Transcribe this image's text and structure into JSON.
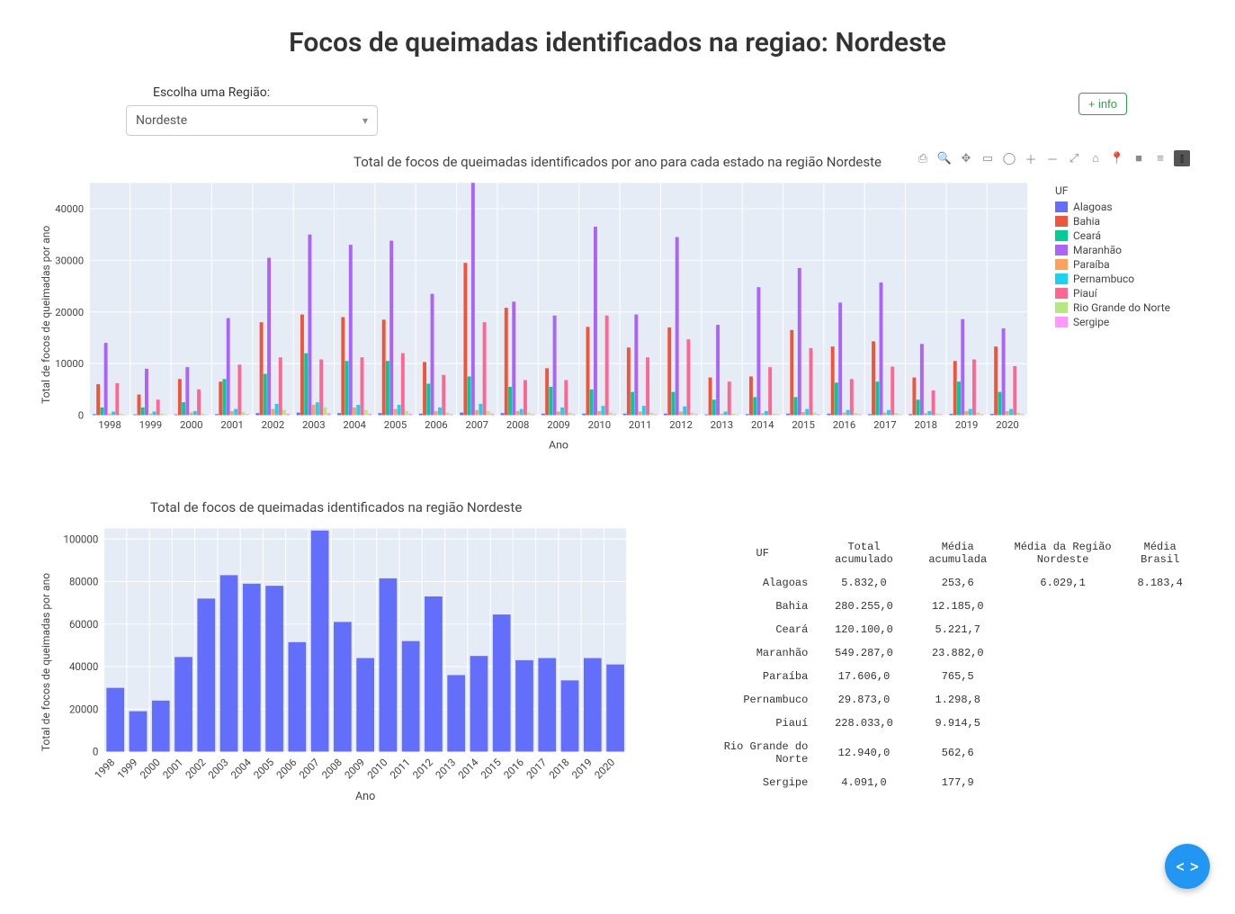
{
  "page": {
    "title": "Focos de queimadas identificados na regiao: Nordeste",
    "region_label": "Escolha uma Região:",
    "region_value": "Nordeste",
    "info_button": "+ info"
  },
  "chart_data": [
    {
      "type": "bar",
      "title": "Total de focos de queimadas identificados por ano para cada estado na região Nordeste",
      "xlabel": "Ano",
      "ylabel": "Total de focos de queimadas por ano",
      "legend": {
        "title": "UF",
        "position": "right"
      },
      "categories": [
        "1998",
        "1999",
        "2000",
        "2001",
        "2002",
        "2003",
        "2004",
        "2005",
        "2006",
        "2007",
        "2008",
        "2009",
        "2010",
        "2011",
        "2012",
        "2013",
        "2014",
        "2015",
        "2016",
        "2017",
        "2018",
        "2019",
        "2020"
      ],
      "yticks": [
        0,
        10000,
        20000,
        30000,
        40000
      ],
      "ylim": [
        0,
        45000
      ],
      "series": [
        {
          "name": "Alagoas",
          "color": "#636efa",
          "values": [
            200,
            150,
            150,
            200,
            400,
            500,
            400,
            400,
            300,
            500,
            400,
            300,
            300,
            300,
            300,
            150,
            200,
            300,
            300,
            200,
            200,
            250,
            250
          ]
        },
        {
          "name": "Bahia",
          "color": "#ef553b",
          "values": [
            6000,
            4000,
            7000,
            6500,
            18000,
            19500,
            19000,
            18500,
            10300,
            29500,
            20800,
            9100,
            17100,
            13100,
            17000,
            7300,
            7500,
            16500,
            13300,
            14300,
            7300,
            10500,
            13300
          ]
        },
        {
          "name": "Ceará",
          "color": "#00cc96",
          "values": [
            1500,
            1500,
            2500,
            7000,
            8000,
            12000,
            10500,
            10500,
            6100,
            7500,
            5500,
            5500,
            5000,
            4500,
            4500,
            3000,
            3500,
            3500,
            6300,
            6500,
            3000,
            6500,
            4500
          ]
        },
        {
          "name": "Maranhão",
          "color": "#ab63fa",
          "values": [
            14000,
            9000,
            9300,
            18800,
            30500,
            35000,
            33000,
            33800,
            23500,
            45000,
            22000,
            19300,
            36500,
            19500,
            34500,
            17500,
            24800,
            28500,
            21800,
            25700,
            13800,
            18600,
            16800
          ]
        },
        {
          "name": "Paraíba",
          "color": "#ffa15a",
          "values": [
            300,
            300,
            500,
            800,
            1200,
            2000,
            1500,
            1200,
            800,
            1000,
            800,
            700,
            800,
            700,
            700,
            300,
            400,
            600,
            500,
            500,
            400,
            800,
            800
          ]
        },
        {
          "name": "Pernambuco",
          "color": "#19d3f3",
          "values": [
            700,
            700,
            800,
            1200,
            2200,
            2500,
            2000,
            2000,
            1500,
            2200,
            1200,
            1500,
            1800,
            1800,
            1700,
            700,
            800,
            1200,
            1000,
            1000,
            800,
            1200,
            1200
          ]
        },
        {
          "name": "Piauí",
          "color": "#ff6692",
          "values": [
            6200,
            3000,
            5000,
            9800,
            11200,
            10800,
            11200,
            12000,
            7800,
            18000,
            6800,
            6800,
            19300,
            11200,
            14700,
            6500,
            9300,
            13000,
            7000,
            9400,
            4800,
            10800,
            9500
          ]
        },
        {
          "name": "Rio Grande do Norte",
          "color": "#b6e880",
          "values": [
            300,
            300,
            300,
            600,
            1000,
            1500,
            1000,
            800,
            500,
            800,
            500,
            500,
            500,
            500,
            500,
            300,
            300,
            500,
            400,
            400,
            300,
            500,
            500
          ]
        },
        {
          "name": "Sergipe",
          "color": "#ff97ff",
          "values": [
            100,
            100,
            100,
            200,
            300,
            400,
            300,
            300,
            200,
            300,
            200,
            200,
            200,
            200,
            200,
            100,
            150,
            200,
            200,
            150,
            150,
            200,
            200
          ]
        }
      ]
    },
    {
      "type": "bar",
      "title": "Total de focos de queimadas identificados na região Nordeste",
      "xlabel": "Ano",
      "ylabel": "Total de focos de queimadas por ano",
      "categories": [
        "1998",
        "1999",
        "2000",
        "2001",
        "2002",
        "2003",
        "2004",
        "2005",
        "2006",
        "2007",
        "2008",
        "2009",
        "2010",
        "2011",
        "2012",
        "2013",
        "2014",
        "2015",
        "2016",
        "2017",
        "2018",
        "2019",
        "2020"
      ],
      "yticks": [
        0,
        20000,
        40000,
        60000,
        80000,
        100000
      ],
      "ylim": [
        0,
        105000
      ],
      "values": [
        30000,
        19000,
        24000,
        44500,
        72000,
        83000,
        79000,
        78000,
        51500,
        104000,
        61000,
        44000,
        81500,
        52000,
        73000,
        36000,
        45000,
        64500,
        43000,
        44000,
        33500,
        44000,
        41000
      ],
      "color": "#636efa"
    }
  ],
  "table": {
    "headers": [
      "UF",
      "Total acumulado",
      "Média acumulada",
      "Média da Região Nordeste",
      "Média Brasil"
    ],
    "rows": [
      {
        "uf": "Alagoas",
        "total": "5.832,0",
        "media": "253,6",
        "media_reg": "6.029,1",
        "media_br": "8.183,4"
      },
      {
        "uf": "Bahia",
        "total": "280.255,0",
        "media": "12.185,0",
        "media_reg": "",
        "media_br": ""
      },
      {
        "uf": "Ceará",
        "total": "120.100,0",
        "media": "5.221,7",
        "media_reg": "",
        "media_br": ""
      },
      {
        "uf": "Maranhão",
        "total": "549.287,0",
        "media": "23.882,0",
        "media_reg": "",
        "media_br": ""
      },
      {
        "uf": "Paraíba",
        "total": "17.606,0",
        "media": "765,5",
        "media_reg": "",
        "media_br": ""
      },
      {
        "uf": "Pernambuco",
        "total": "29.873,0",
        "media": "1.298,8",
        "media_reg": "",
        "media_br": ""
      },
      {
        "uf": "Piauí",
        "total": "228.033,0",
        "media": "9.914,5",
        "media_reg": "",
        "media_br": ""
      },
      {
        "uf": "Rio Grande do Norte",
        "total": "12.940,0",
        "media": "562,6",
        "media_reg": "",
        "media_br": ""
      },
      {
        "uf": "Sergipe",
        "total": "4.091,0",
        "media": "177,9",
        "media_reg": "",
        "media_br": ""
      }
    ]
  },
  "modebar": {
    "buttons": [
      {
        "name": "download-plot-icon",
        "glyph": "⎙"
      },
      {
        "name": "zoom-icon",
        "glyph": "🔍"
      },
      {
        "name": "pan-icon",
        "glyph": "✥"
      },
      {
        "name": "box-select-icon",
        "glyph": "▭"
      },
      {
        "name": "lasso-select-icon",
        "glyph": "◯"
      },
      {
        "name": "zoom-in-icon",
        "glyph": "＋"
      },
      {
        "name": "zoom-out-icon",
        "glyph": "－"
      },
      {
        "name": "autoscale-icon",
        "glyph": "⤢"
      },
      {
        "name": "reset-axes-icon",
        "glyph": "⌂"
      },
      {
        "name": "toggle-spike-icon",
        "glyph": "📍"
      },
      {
        "name": "hover-closest-icon",
        "glyph": "■"
      },
      {
        "name": "hover-compare-icon",
        "glyph": "≡"
      },
      {
        "name": "plotly-logo-icon",
        "glyph": "⫾",
        "active": true
      }
    ]
  }
}
